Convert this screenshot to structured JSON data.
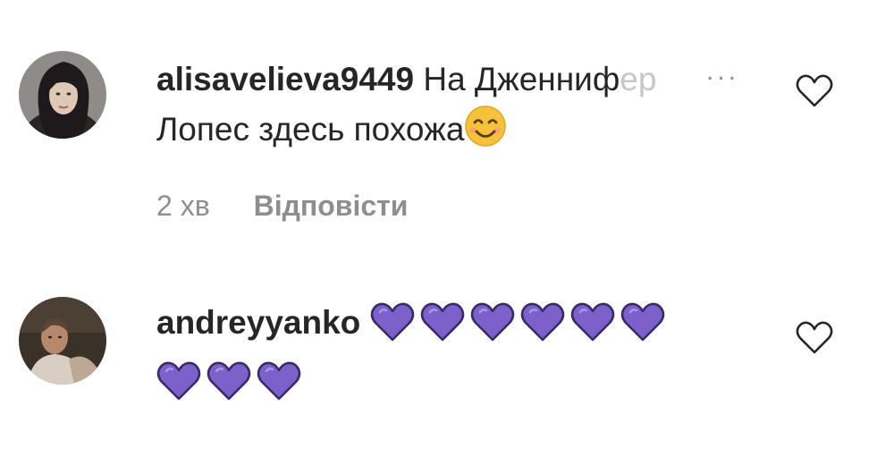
{
  "comments": [
    {
      "username": "alisavelieva9449",
      "text_visible": "На Дженниф",
      "text_faded": "ер",
      "text_line2": "Лопес здесь похожа",
      "emoji": "smiling-face-icon",
      "time": "2 хв",
      "reply_label": "Відповісти",
      "more_label": "..."
    },
    {
      "username": "andreyyanko",
      "emoji": "purple-heart-icon",
      "emoji_count": 9
    }
  ],
  "colors": {
    "text": "#262626",
    "meta": "#8e8e8e",
    "faded": "#c7c7c7",
    "heart": "#7b61c9",
    "smiley": "#f7c23b"
  }
}
